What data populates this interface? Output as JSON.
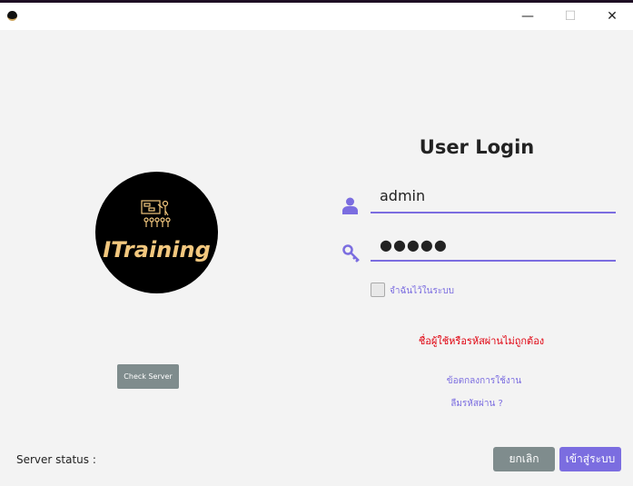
{
  "window": {
    "minimize": "—",
    "maximize": "☐",
    "close": "✕"
  },
  "logo": {
    "text": "ITraining"
  },
  "check_server_label": "Check Server",
  "server_status_label": "Server status  :",
  "login": {
    "title": "User Login",
    "username": "admin",
    "password_masked": "●●●●●",
    "remember_label": "จำฉันไว้ในระบบ",
    "error": "ชื่อผู้ใช้หรือรหัสผ่านไม่ถูกต้อง",
    "terms_link": "ข้อตกลงการใช้งาน",
    "forgot_link": "ลืมรหัสผ่าน ?",
    "cancel_label": "ยกเลิก",
    "login_label": "เข้าสู่ระบบ"
  },
  "colors": {
    "accent": "#7b6de0",
    "error": "#e0000e",
    "gray_button": "#7f8c8d"
  }
}
